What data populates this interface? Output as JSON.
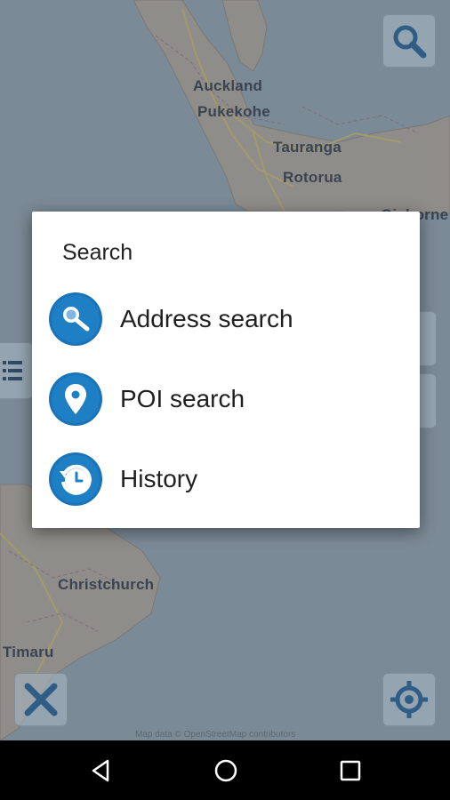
{
  "map": {
    "labels": {
      "auckland": "Auckland",
      "pukekohe": "Pukekohe",
      "tauranga": "Tauranga",
      "rotorua": "Rotorua",
      "gisborne": "Gisborne",
      "christchurch": "Christchurch",
      "timaru": "Timaru"
    },
    "credit": "Map data © OpenStreetMap contributors",
    "colors": {
      "sea": "#7a8a96",
      "land": "#b7b0a8",
      "road": "#c9b86a",
      "border": "#8c6f82"
    }
  },
  "map_controls": {
    "search_icon": "search-icon",
    "close_icon": "close-icon",
    "locate_icon": "locate-icon",
    "list_icon": "list-icon"
  },
  "dialog": {
    "title": "Search",
    "items": [
      {
        "label": "Address search",
        "icon": "address-search-icon"
      },
      {
        "label": "POI search",
        "icon": "location-pin-icon"
      },
      {
        "label": "History",
        "icon": "history-icon"
      }
    ],
    "accent_color": "#1a73b8"
  },
  "navbar": {
    "back_icon": "back-icon",
    "home_icon": "home-icon",
    "recents_icon": "recents-icon"
  }
}
